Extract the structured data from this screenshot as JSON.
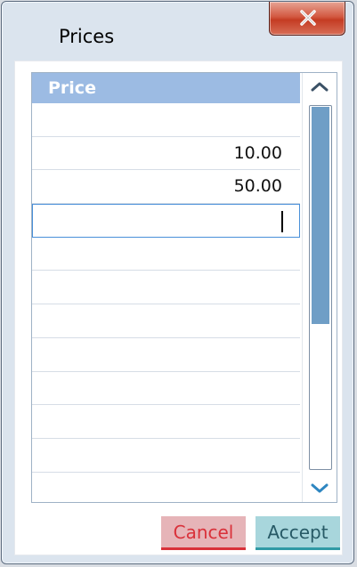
{
  "window": {
    "title": "Prices"
  },
  "icons": {
    "close": "close-x-icon",
    "scroll_up": "chevron-up-icon",
    "scroll_down": "chevron-down-icon"
  },
  "grid": {
    "header": "Price",
    "rows": [
      "",
      "10.00",
      "50.00",
      "",
      "",
      "",
      "",
      "",
      "",
      "",
      "",
      ""
    ],
    "editing_row_index": 3
  },
  "scrollbar": {
    "thumb_fraction_visible": 0.6
  },
  "buttons": {
    "cancel": "Cancel",
    "accept": "Accept"
  },
  "colors": {
    "header_bg": "#9cbbe3",
    "cancel_accent": "#d9313a",
    "accept_accent": "#2f9aa5",
    "close_button": "#c43c23"
  }
}
